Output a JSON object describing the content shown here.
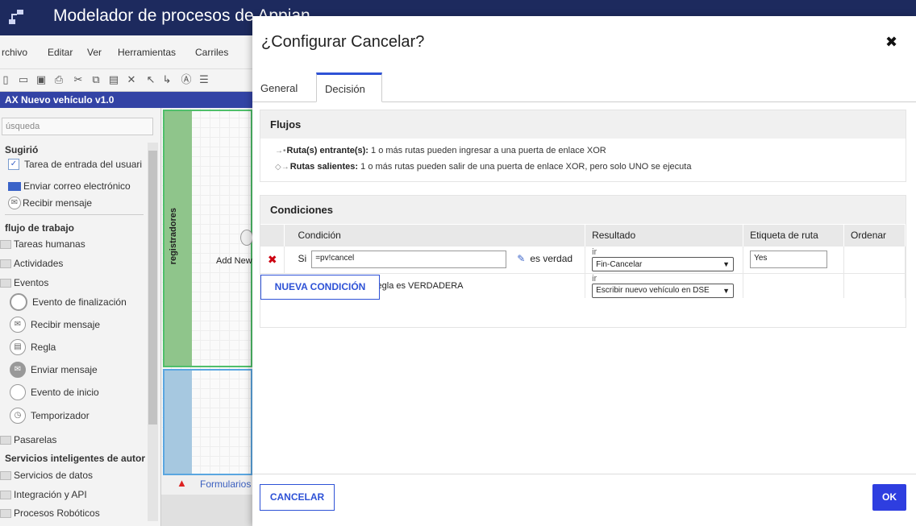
{
  "app": {
    "title": "Modelador de procesos de Appian",
    "model_title": "AX Nuevo vehículo v1.0"
  },
  "menu": [
    "rchivo",
    "Editar",
    "Ver",
    "Herramientas",
    "Carriles"
  ],
  "palette": {
    "search_placeholder": "úsqueda",
    "suggested_head": "Sugirió",
    "suggested": [
      "Tarea de entrada del usuari",
      "Enviar correo electrónico",
      "Recibir mensaje"
    ],
    "workflow_head": "flujo de trabajo",
    "folders_top": [
      "Tareas humanas",
      "Actividades",
      "Eventos"
    ],
    "events": [
      "Evento de finalización",
      "Recibir mensaje",
      "Regla",
      "Enviar mensaje",
      "Evento de inicio",
      "Temporizador"
    ],
    "folders_bottom": [
      "Pasarelas"
    ],
    "smart_head": "Servicios inteligentes de autor",
    "folders_smart": [
      "Servicios de datos",
      "Integración y API",
      "Procesos Robóticos"
    ]
  },
  "canvas": {
    "lane_label": "registradores",
    "node_label": "Add New",
    "forms_link": "Formularios"
  },
  "modal": {
    "title": "¿Configurar Cancelar?",
    "tabs": [
      "General",
      "Decisión"
    ],
    "active_tab": "Decisión",
    "flows": {
      "heading": "Flujos",
      "incoming_label": "Ruta(s) entrante(s):",
      "incoming_text": "1 o más rutas pueden ingresar a una puerta de enlace XOR",
      "outgoing_label": "Rutas salientes:",
      "outgoing_text": "1 o más rutas pueden salir de una puerta de enlace XOR, pero solo UNO se ejecuta"
    },
    "conditions": {
      "heading": "Condiciones",
      "columns": [
        "Condición",
        "Resultado",
        "Etiqueta de ruta",
        "Ordenar"
      ],
      "rows": [
        {
          "si_label": "Si",
          "expression": "=pv!cancel",
          "is_true_label": "es verdad",
          "result_prefix": "ir",
          "result": "Fin-Cancelar",
          "route_label": "Yes"
        }
      ],
      "else_row": {
        "text": "De lo contrario, si ninguna regla es VERDADERA",
        "result_prefix": "ir",
        "result": "Escribir nuevo vehículo en DSE"
      },
      "new_condition_label": "NUEVA CONDICIÓN"
    },
    "cancel_label": "CANCELAR",
    "ok_label": "OK"
  },
  "colors": {
    "title_bar": "#1d2a5e",
    "model_bar": "#3343a5",
    "accent": "#2e52d6",
    "ok_button": "#2e3ee0",
    "delete_red": "#cc0011",
    "lane_green": "#8fc58b",
    "lane_blue": "#a6c8e0"
  }
}
